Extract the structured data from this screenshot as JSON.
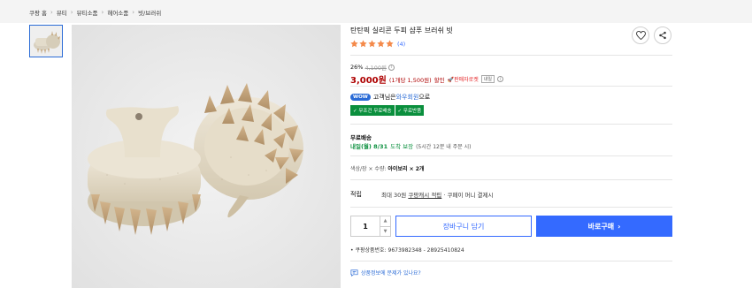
{
  "breadcrumb": [
    "쿠팡 홈",
    "뷰티",
    "뷰티소품",
    "헤어소품",
    "빗/브러쉬"
  ],
  "product": {
    "title": "탄탄픽 실리콘 두피 샴푸 브러쉬 빗",
    "rating": 5,
    "review_count": "(4)"
  },
  "pricing": {
    "discount_rate": "26%",
    "original_price": "4,100원",
    "price": "3,000원",
    "unit_price": "(1개당 1,500원)",
    "sale_label": "할인",
    "price_compare": "🚀판매자로켓",
    "mini_badge": "내일"
  },
  "wow": {
    "badge": "WOW",
    "text_prefix": "고객님은 ",
    "link": "와우회원",
    "text_suffix": "으로"
  },
  "benefits": [
    "✓ 무조건 무료배송",
    "✓ 무료반품"
  ],
  "shipping": {
    "title": "무료배송",
    "date": "내일(월) 8/31",
    "guarantee": "도착 보장",
    "cutoff": "(5시간 12분 내 주문 시)"
  },
  "option": {
    "label": "색상/장 × 수량: ",
    "value": "아이보리 × 2개"
  },
  "points": {
    "label": "적립",
    "prefix": "최대 30원 ",
    "link": "쿠팡캐시 적립",
    "suffix": " · 쿠페이 머니 결제시"
  },
  "quantity": "1",
  "buttons": {
    "cart": "장바구니 담기",
    "buy": "바로구매",
    "buy_arrow": "›"
  },
  "product_number": "• 쿠팡상품번호: 9673982348 - 28925410824",
  "report_text": "상품정보에 문제가 있나요?",
  "colors": {
    "accent": "#346aff",
    "price": "#ae0000",
    "rating": "#f48a4b",
    "green": "#0a8f3d"
  },
  "icons": [
    "heart-icon",
    "share-icon",
    "star-icon",
    "info-icon",
    "chat-report-icon"
  ]
}
